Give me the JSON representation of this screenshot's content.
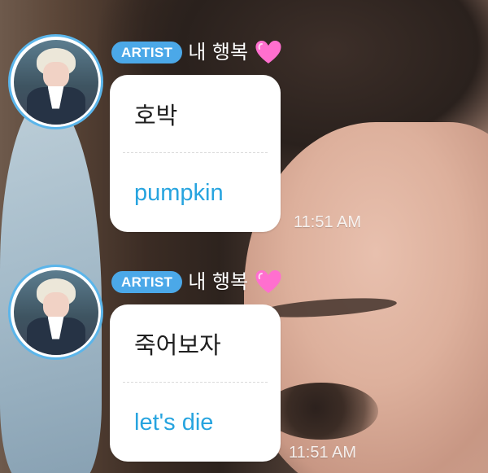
{
  "messages": [
    {
      "badge": "ARTIST",
      "sender": "내 행복",
      "heart_icon": "pink-heart-icon",
      "original": "호박",
      "translation": "pumpkin",
      "time": "11:51 AM"
    },
    {
      "badge": "ARTIST",
      "sender": "내 행복",
      "heart_icon": "pink-heart-icon",
      "original": "죽어보자",
      "translation": "let's die",
      "time": "11:51 AM"
    }
  ],
  "colors": {
    "badge": "#4ba8e8",
    "translation": "#27a4df",
    "avatar_ring": "#5bb5ea",
    "heart": "#ff6fcf"
  }
}
